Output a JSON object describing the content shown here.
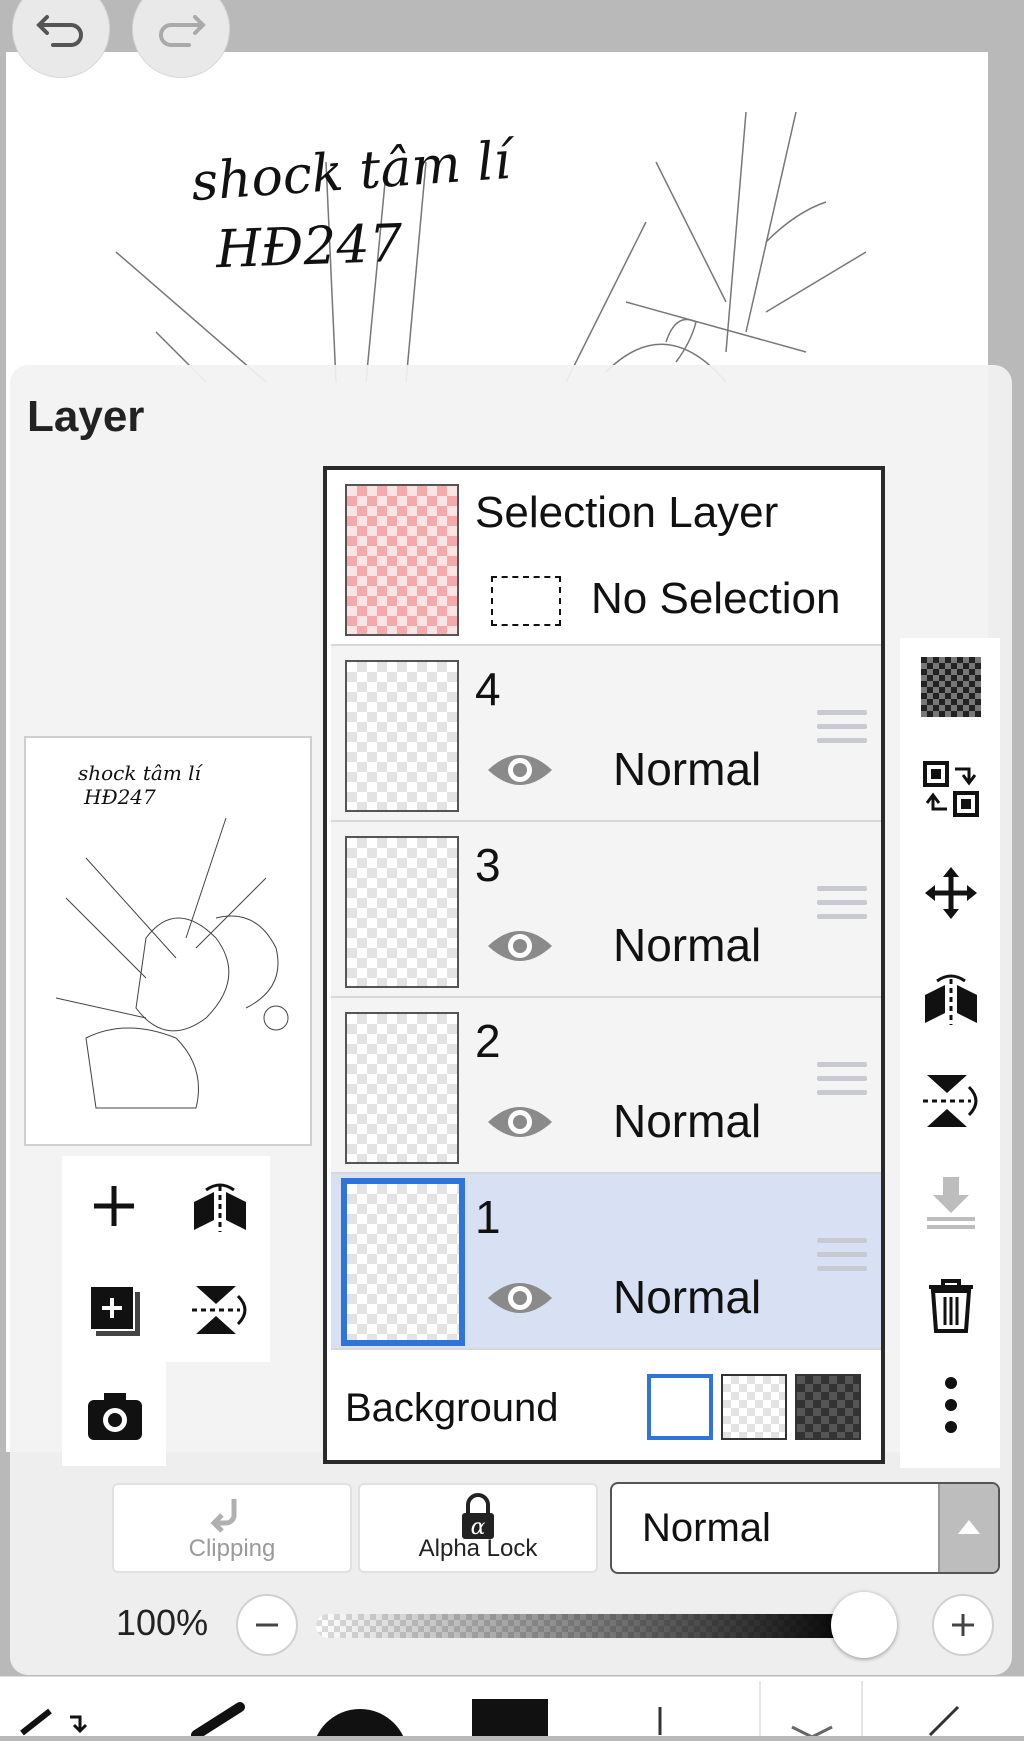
{
  "panel": {
    "title": "Layer"
  },
  "canvas_text": [
    "shock tâm lí",
    "HĐ247"
  ],
  "selection_layer": {
    "name": "Selection Layer",
    "status": "No Selection"
  },
  "layers": [
    {
      "name": "4",
      "blend": "Normal",
      "selected": false
    },
    {
      "name": "3",
      "blend": "Normal",
      "selected": false
    },
    {
      "name": "2",
      "blend": "Normal",
      "selected": false
    },
    {
      "name": "1",
      "blend": "Normal",
      "selected": true
    }
  ],
  "background": {
    "label": "Background",
    "options": [
      "white",
      "transparent",
      "dark-checker"
    ],
    "selected": "white"
  },
  "side_tools": [
    "checker-icon",
    "transfer-icon",
    "move-icon",
    "flip-horizontal-icon",
    "flip-vertical-icon",
    "merge-down-icon",
    "trash-icon",
    "more-icon"
  ],
  "left_tools": [
    "add-layer-icon",
    "flip-horizontal-icon",
    "add-folder-icon",
    "flip-vertical-icon",
    "camera-icon"
  ],
  "bottom": {
    "clipping_label": "Clipping",
    "alpha_lock_label": "Alpha Lock",
    "blend_mode": "Normal",
    "opacity_label": "100%",
    "opacity": 1.0
  },
  "colors": {
    "accent": "#2f74d8",
    "selected_row": "#d7e1f3",
    "selection_thumb": "#f5a9ab"
  }
}
